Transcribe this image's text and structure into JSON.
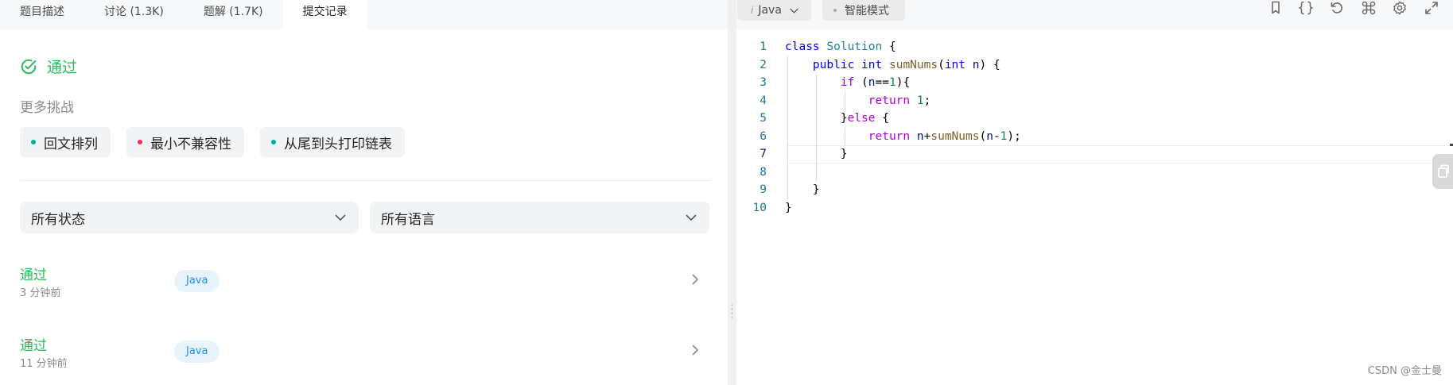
{
  "tabs": [
    "题目描述",
    "讨论 (1.3K)",
    "题解 (1.7K)",
    "提交记录"
  ],
  "active_tab_index": 3,
  "result": {
    "status": "通过"
  },
  "more_challenges": {
    "title": "更多挑战",
    "items": [
      {
        "label": "回文排列",
        "dot_color": "#00af9b"
      },
      {
        "label": "最小不兼容性",
        "dot_color": "#ff2d55"
      },
      {
        "label": "从尾到头打印链表",
        "dot_color": "#00af9b"
      }
    ]
  },
  "filters": {
    "status": "所有状态",
    "language": "所有语言"
  },
  "submissions": [
    {
      "status": "通过",
      "time": "3 分钟前",
      "language": "Java"
    },
    {
      "status": "通过",
      "time": "11 分钟前",
      "language": "Java"
    }
  ],
  "editor": {
    "language_icon": "i",
    "language": "Java",
    "mode": "智能模式",
    "toolbar_icons": [
      "bookmark-icon",
      "braces-icon",
      "reset-icon",
      "command-icon",
      "gear-icon",
      "fullscreen-icon"
    ],
    "current_line": 7,
    "line_numbers": [
      "1",
      "2",
      "3",
      "4",
      "5",
      "6",
      "7",
      "8",
      "9",
      "10"
    ]
  },
  "watermark": "CSDN @金士曼",
  "colors": {
    "accepted": "#2cbb5d",
    "badge_text": "#1a90ff",
    "badge_bg": "#e7f3fd"
  }
}
